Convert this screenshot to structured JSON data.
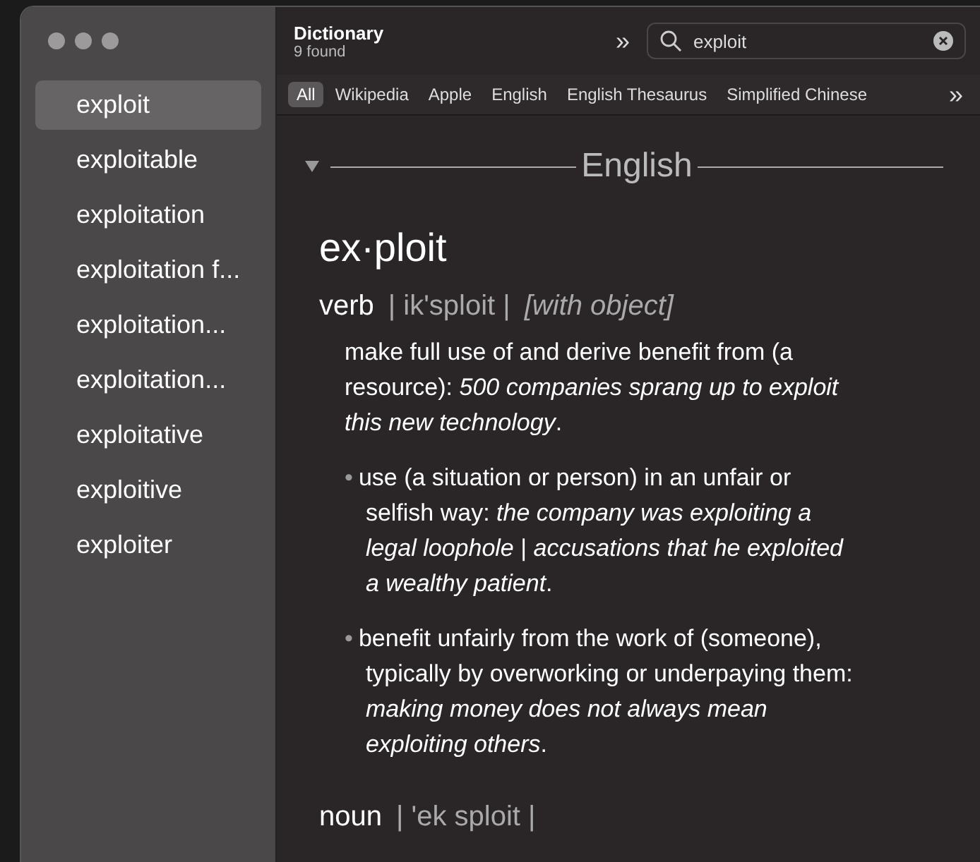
{
  "sidebar": {
    "items": [
      {
        "label": "exploit",
        "selected": true
      },
      {
        "label": "exploitable",
        "selected": false
      },
      {
        "label": "exploitation",
        "selected": false
      },
      {
        "label": "exploitation f...",
        "selected": false
      },
      {
        "label": "exploitation...",
        "selected": false
      },
      {
        "label": "exploitation...",
        "selected": false
      },
      {
        "label": "exploitative",
        "selected": false
      },
      {
        "label": "exploitive",
        "selected": false
      },
      {
        "label": "exploiter",
        "selected": false
      }
    ]
  },
  "header": {
    "title": "Dictionary",
    "count": "9 found",
    "more": "»"
  },
  "search": {
    "value": "exploit"
  },
  "tabs": [
    {
      "label": "All",
      "selected": true
    },
    {
      "label": "Wikipedia",
      "selected": false
    },
    {
      "label": "Apple",
      "selected": false
    },
    {
      "label": "English",
      "selected": false
    },
    {
      "label": "English Thesaurus",
      "selected": false
    },
    {
      "label": "Simplified Chinese",
      "selected": false
    }
  ],
  "tabs_more": "»",
  "entry": {
    "section": "English",
    "expanded": true,
    "headword": "ex·ploit",
    "senses": [
      {
        "pos": "verb",
        "pronunciation": "| ik'sploit |",
        "grammar": "[with object]",
        "definitions": [
          {
            "kind": "main",
            "text": "make full use of and derive benefit from (a resource): *500 companies sprang up to exploit this new technology*."
          },
          {
            "kind": "sub",
            "marker": "•",
            "text": "use (a situation or person) in an unfair or selfish way: *the company was exploiting a legal loophole* | *accusations that he exploited a wealthy patient*."
          },
          {
            "kind": "sub",
            "marker": "•",
            "text": "benefit unfairly from the work of (someone), typically by overworking or underpaying them: *making money does not always mean exploiting others*."
          }
        ]
      },
      {
        "pos": "noun",
        "pronunciation": "| 'ek sploit |"
      }
    ]
  }
}
